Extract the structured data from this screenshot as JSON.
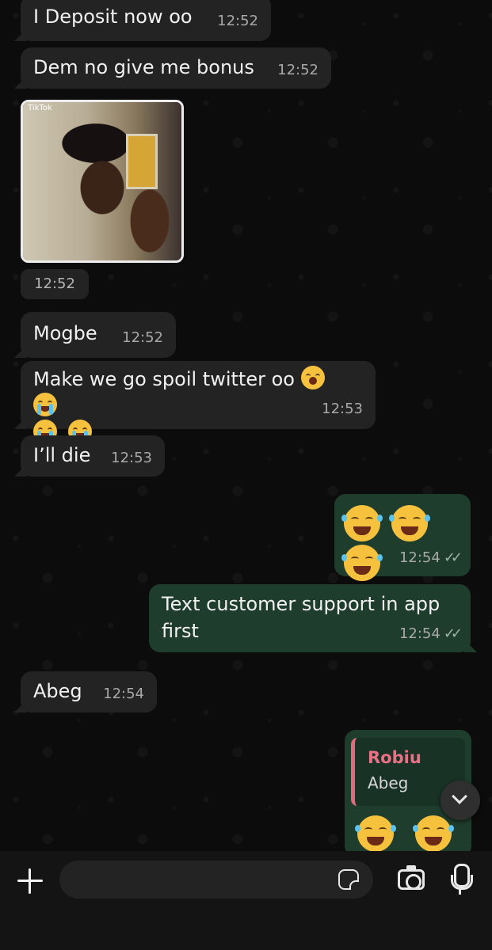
{
  "messages": [
    {
      "text": "I Deposit now oo",
      "time": "12:52"
    },
    {
      "text": "Dem no give me bonus",
      "time": "12:52"
    },
    {
      "media": {
        "overlay": "TikTok",
        "time": "12:52"
      }
    },
    {
      "text": "Mogbe",
      "time": "12:52"
    },
    {
      "text": "Make we go spoil twitter oo",
      "time": "12:53"
    },
    {
      "text": "I’ll die",
      "time": "12:53"
    },
    {
      "emojis": [
        "laughing-tears",
        "laughing-tears",
        "laughing-tears"
      ],
      "time": "12:54",
      "status": "read"
    },
    {
      "text": "Text customer support in app first",
      "time": "12:54",
      "status": "read"
    },
    {
      "text": "Abeg",
      "time": "12:54"
    },
    {
      "reply_to": {
        "name": "Robiu",
        "text": "Abeg"
      },
      "emojis": [
        "laughing-tears",
        "laughing-tears"
      ]
    }
  ],
  "colors": {
    "incoming": "#232323",
    "outgoing": "#1f3d2d",
    "reply_name": "#ea7085"
  },
  "composer": {
    "placeholder": ""
  }
}
